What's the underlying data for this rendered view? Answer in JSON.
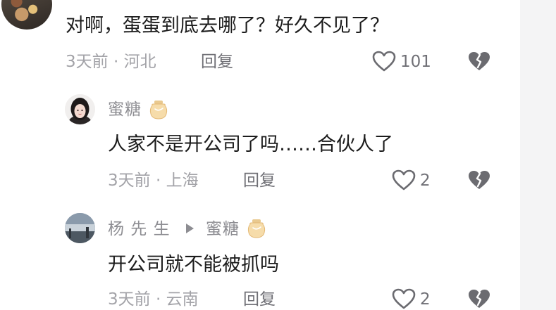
{
  "comments": [
    {
      "text": "对啊，蛋蛋到底去哪了？好久不见了？",
      "time_location": "3天前 · 河北",
      "reply_label": "回复",
      "likes": "101"
    },
    {
      "author": "蜜糖",
      "text": "人家不是开公司了吗……合伙人了",
      "time_location": "3天前 · 上海",
      "reply_label": "回复",
      "likes": "2"
    },
    {
      "author": "杨 先 生",
      "reply_to": "蜜糖",
      "text": "开公司就不能被抓吗",
      "time_location": "3天前 · 云南",
      "reply_label": "回复",
      "likes": "2"
    }
  ],
  "icons": {
    "like": "heart-outline-icon",
    "dislike": "broken-heart-icon",
    "badge": "honey-jar-badge-icon",
    "reply_arrow": "play-triangle-icon"
  }
}
